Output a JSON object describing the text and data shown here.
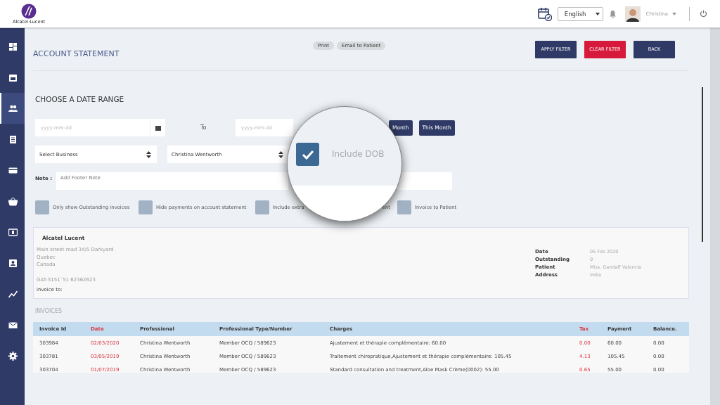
{
  "topbar": {
    "logo_text": "Alcatel·Lucent",
    "language": "English",
    "user": "Christina"
  },
  "sidebar": {
    "items": [
      {
        "kind": "dashboard",
        "selected": false
      },
      {
        "kind": "calendar",
        "selected": false
      },
      {
        "kind": "people",
        "selected": true
      },
      {
        "kind": "list",
        "selected": false
      },
      {
        "kind": "card",
        "selected": false
      },
      {
        "kind": "basket",
        "selected": false
      },
      {
        "kind": "money",
        "selected": false
      },
      {
        "kind": "contact",
        "selected": false
      },
      {
        "kind": "chart",
        "selected": false
      },
      {
        "kind": "mail",
        "selected": false
      },
      {
        "kind": "gear",
        "selected": false
      }
    ]
  },
  "header": {
    "title": "ACCOUNT STATEMENT",
    "actions": [
      "Print",
      "Email to Patient"
    ],
    "buttons": [
      {
        "label": "APPLY FILTER",
        "kind": "primary"
      },
      {
        "label": "CLEAR FILTER",
        "kind": "danger"
      },
      {
        "label": "BACK",
        "kind": "primary"
      }
    ]
  },
  "form": {
    "heading": "CHOOSE A DATE RANGE",
    "from_placeholder": "yyyy-mm-dd",
    "to_label": "To",
    "to_placeholder": "yyyy-mm-dd",
    "range_buttons": [
      "Month",
      "This Month"
    ],
    "selects": [
      "Select Business",
      "Christina Wentworth"
    ],
    "note_label": "Note :",
    "note_placeholder": "Add Footer Note",
    "checkboxes": [
      {
        "label": "Only show Outstanding invoices",
        "checked": false
      },
      {
        "label": "Hide payments on account statement",
        "checked": false
      },
      {
        "label": "Include extra",
        "tail": "ent",
        "checked": false
      },
      {
        "label": "Invoice to Patient",
        "checked": false
      }
    ]
  },
  "magnifier": {
    "label": "Include DOB",
    "checked": true
  },
  "statement": {
    "company": "Alcatel Lucent",
    "address": [
      "Main street road 34/5 Darkyard",
      "Quebec",
      "Canada"
    ],
    "tax_id": "GAT-3151`51 62362623",
    "invoice_to": "invoice to:",
    "details": [
      {
        "label": "Date",
        "value": "05 Feb 2020"
      },
      {
        "label": "Outstanding",
        "value": "0"
      },
      {
        "label": "Patient",
        "value": "Miss. Gandalf Valencia"
      },
      {
        "label": "Address",
        "value": "India"
      }
    ]
  },
  "invoices": {
    "heading": "INVOICES",
    "columns": [
      {
        "label": "Invoice Id",
        "accent": false
      },
      {
        "label": "Date",
        "accent": true
      },
      {
        "label": "Professional",
        "accent": false
      },
      {
        "label": "Professional Type/Number",
        "accent": false
      },
      {
        "label": "Charges",
        "accent": false
      },
      {
        "label": "Tax",
        "accent": true
      },
      {
        "label": "Payment",
        "accent": false
      },
      {
        "label": "Balance.",
        "accent": false
      }
    ],
    "rows": [
      [
        "303984",
        "02/03/2020",
        "Christina Wentworth",
        "Member OCQ / 589623",
        "Ajustement et thérapie complémentaire: 60.00",
        "0.00",
        "60.00",
        "0.00"
      ],
      [
        "303781",
        "03/05/2019",
        "Christina Wentworth",
        "Member OCQ / 589623",
        "Traitement chiropratique,Ajustement et thérapie complémentaire: 105.45",
        "4.13",
        "105.45",
        "0.00"
      ],
      [
        "303704",
        "01/07/2019",
        "Christina Wentworth",
        "Member OCQ / 589623",
        "Standard consultation and treatment,Aloe Mask Crème(0002): 55.00",
        "0.65",
        "55.00",
        "0.00"
      ]
    ]
  }
}
